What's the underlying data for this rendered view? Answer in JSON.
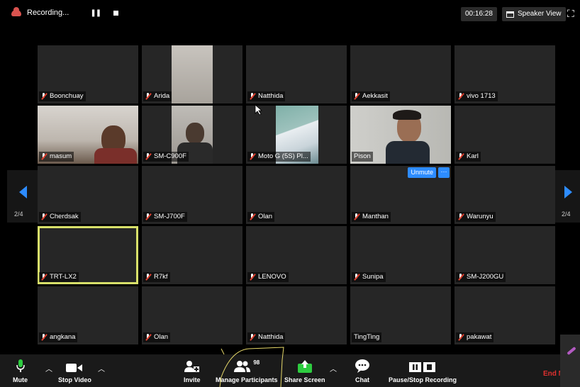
{
  "topbar": {
    "recording_label": "Recording...",
    "timer": "00:16:28",
    "speaker_view_label": "Speaker View"
  },
  "pagination": {
    "left": "2/4",
    "right": "2/4"
  },
  "tiles": [
    {
      "name": "Boonchuay",
      "muted": true,
      "video": "none"
    },
    {
      "name": "Arida",
      "muted": true,
      "video": "arida"
    },
    {
      "name": "Natthida",
      "muted": true,
      "video": "none"
    },
    {
      "name": "Aekkasit",
      "muted": true,
      "video": "none"
    },
    {
      "name": "vivo 1713",
      "muted": true,
      "video": "none"
    },
    {
      "name": "masum",
      "muted": true,
      "video": "masum"
    },
    {
      "name": "SM-C900F",
      "muted": true,
      "video": "smc900f"
    },
    {
      "name": "Moto G (5S) Pl...",
      "muted": true,
      "video": "moto"
    },
    {
      "name": "Pison",
      "muted": false,
      "video": "pison"
    },
    {
      "name": "Karl",
      "muted": true,
      "video": "none"
    },
    {
      "name": "Cherdsak",
      "muted": true,
      "video": "none"
    },
    {
      "name": "SM-J700F",
      "muted": true,
      "video": "none"
    },
    {
      "name": "Olan",
      "muted": true,
      "video": "none"
    },
    {
      "name": "Manthan",
      "muted": true,
      "video": "none"
    },
    {
      "name": "Warunyu",
      "muted": true,
      "video": "none"
    },
    {
      "name": "TRT-LX2",
      "muted": true,
      "video": "none"
    },
    {
      "name": "R7kf",
      "muted": true,
      "video": "none"
    },
    {
      "name": "LENOVO",
      "muted": true,
      "video": "none"
    },
    {
      "name": "Sunipa",
      "muted": true,
      "video": "none"
    },
    {
      "name": "SM-J200GU",
      "muted": true,
      "video": "none"
    },
    {
      "name": "angkana",
      "muted": true,
      "video": "none"
    },
    {
      "name": "Olan",
      "muted": true,
      "video": "none"
    },
    {
      "name": "Natthida",
      "muted": true,
      "video": "none"
    },
    {
      "name": "TingTing",
      "muted": false,
      "video": "none"
    },
    {
      "name": "pakawat",
      "muted": true,
      "video": "none"
    }
  ],
  "active_speaker_index": 15,
  "hover_controls": {
    "tile_index": 13,
    "unmute_label": "Unmute",
    "more_label": "···"
  },
  "toolbar": {
    "mute": "Mute",
    "stop_video": "Stop Video",
    "invite": "Invite",
    "manage_participants": "Manage Participants",
    "participant_count": "98",
    "share_screen": "Share Screen",
    "chat": "Chat",
    "pause_stop_recording": "Pause/Stop Recording",
    "end_meeting": "End Me"
  },
  "colors": {
    "accent": "#2d8cff",
    "share_green": "#2ecc40",
    "end_red": "#e0302f",
    "active_border": "#d8e06a"
  }
}
